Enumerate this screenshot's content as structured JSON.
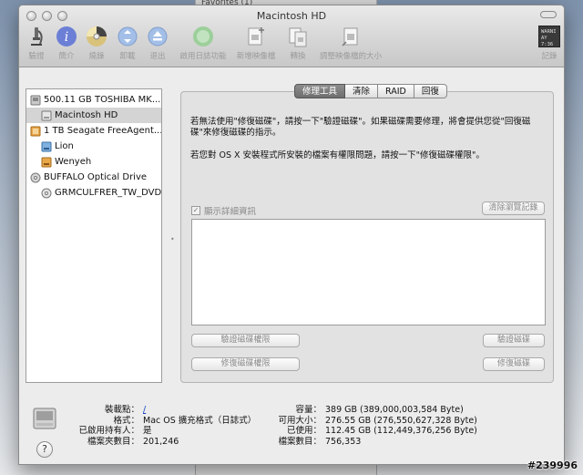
{
  "window": {
    "title": "Macintosh HD"
  },
  "background": {
    "window_title": "Favorites (1)"
  },
  "toolbar": {
    "items": [
      {
        "label": "驗證",
        "icon": "microscope-icon"
      },
      {
        "label": "簡介",
        "icon": "info-icon"
      },
      {
        "label": "燒錄",
        "icon": "burn-disc-icon"
      },
      {
        "label": "卸載",
        "icon": "unmount-icon"
      },
      {
        "label": "退出",
        "icon": "eject-icon"
      },
      {
        "label": "啟用日誌功能",
        "icon": "journal-icon"
      },
      {
        "label": "新增映像檔",
        "icon": "new-image-icon"
      },
      {
        "label": "轉換",
        "icon": "convert-icon"
      },
      {
        "label": "調整映像檔的大小",
        "icon": "resize-image-icon"
      },
      {
        "label": "記錄",
        "icon": "log-icon",
        "badge_lines": [
          "WARNI",
          "AY 7:36"
        ]
      }
    ]
  },
  "sidebar": {
    "items": [
      {
        "label": "500.11 GB TOSHIBA MK...",
        "icon": "internal-disk-icon",
        "level": 0,
        "selected": false
      },
      {
        "label": "Macintosh HD",
        "icon": "volume-icon",
        "level": 1,
        "selected": true
      },
      {
        "label": "1 TB Seagate FreeAgent...",
        "icon": "external-disk-icon",
        "level": 0,
        "selected": false
      },
      {
        "label": "Lion",
        "icon": "volume-blue-icon",
        "level": 1,
        "selected": false
      },
      {
        "label": "Wenyeh",
        "icon": "volume-orange-icon",
        "level": 1,
        "selected": false
      },
      {
        "label": "BUFFALO Optical Drive",
        "icon": "optical-drive-icon",
        "level": 0,
        "selected": false
      },
      {
        "label": "GRMCULFRER_TW_DVD",
        "icon": "dvd-icon",
        "level": 1,
        "selected": false
      }
    ]
  },
  "tabs": [
    {
      "label": "修理工具",
      "active": true
    },
    {
      "label": "清除",
      "active": false
    },
    {
      "label": "RAID",
      "active": false
    },
    {
      "label": "回復",
      "active": false
    }
  ],
  "main": {
    "description_1": "若無法使用\"修復磁碟\"，請按一下\"驗證磁碟\"。如果磁碟需要修理，將會提供您從\"回復磁碟\"來修復磁碟的指示。",
    "description_2": "若您對 OS X 安裝程式所安裝的檔案有權限問題，請按一下\"修復磁碟權限\"。",
    "show_details_label": "顯示詳細資訊",
    "show_details_checked": true,
    "clear_history_label": "清除瀏覽記錄",
    "verify_permissions_label": "驗證磁碟權限",
    "repair_permissions_label": "修復磁碟權限",
    "verify_disk_label": "驗證磁碟",
    "repair_disk_label": "修復磁碟"
  },
  "footer": {
    "mount_point_label": "裝載點：",
    "mount_point_value": "/",
    "format_label": "格式：",
    "format_value": "Mac OS 擴充格式（日誌式）",
    "owners_enabled_label": "已啟用持有人：",
    "owners_enabled_value": "是",
    "folder_count_label": "檔案夾數目：",
    "folder_count_value": "201,246",
    "capacity_label": "容量：",
    "capacity_value": "389 GB (389,000,003,584 Byte)",
    "available_label": "可用大小：",
    "available_value": "276.55 GB (276,550,627,328 Byte)",
    "used_label": "已使用：",
    "used_value": "112.45 GB (112,449,376,256 Byte)",
    "file_count_label": "檔案數目：",
    "file_count_value": "756,353",
    "help_label": "?"
  },
  "watermark": "#239996",
  "colors": {
    "window_bg": "#ececec",
    "selection": "#d4d4d4",
    "active_tab": "#7a7a7a",
    "disabled_text": "#888888",
    "link": "#1a44c2"
  }
}
